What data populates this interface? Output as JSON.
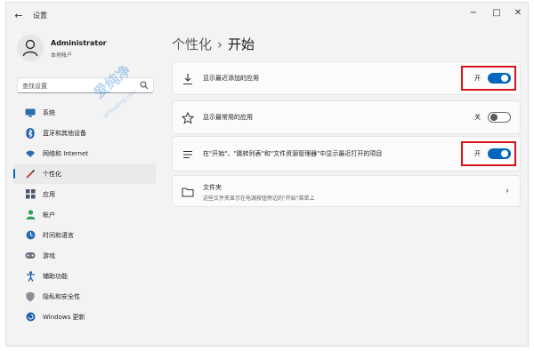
{
  "window": {
    "title": "设置",
    "back_glyph": "←",
    "minimize_glyph": "−",
    "maximize_glyph": "□",
    "close_glyph": "✕"
  },
  "profile": {
    "name": "Administrator",
    "account_type": "本地帐户"
  },
  "search": {
    "placeholder": "查找设置"
  },
  "sidebar": {
    "items": [
      {
        "label": "系统",
        "icon": "monitor-icon",
        "selected": false
      },
      {
        "label": "蓝牙和其他设备",
        "icon": "bluetooth-icon",
        "selected": false
      },
      {
        "label": "网络和 Internet",
        "icon": "wifi-icon",
        "selected": false
      },
      {
        "label": "个性化",
        "icon": "brush-icon",
        "selected": true
      },
      {
        "label": "应用",
        "icon": "apps-icon",
        "selected": false
      },
      {
        "label": "帐户",
        "icon": "person-icon",
        "selected": false
      },
      {
        "label": "时间和语言",
        "icon": "globe-clock-icon",
        "selected": false
      },
      {
        "label": "游戏",
        "icon": "gamepad-icon",
        "selected": false
      },
      {
        "label": "辅助功能",
        "icon": "accessibility-icon",
        "selected": false
      },
      {
        "label": "隐私和安全性",
        "icon": "shield-icon",
        "selected": false
      },
      {
        "label": "Windows 更新",
        "icon": "update-icon",
        "selected": false
      }
    ]
  },
  "main": {
    "breadcrumb_parent": "个性化",
    "breadcrumb_separator": "›",
    "breadcrumb_current": "开始",
    "settings": [
      {
        "label": "显示最近添加的应用",
        "icon": "download-icon",
        "state_text": "开",
        "on": true,
        "highlighted": true
      },
      {
        "label": "显示最常用的应用",
        "icon": "star-icon",
        "state_text": "关",
        "on": false,
        "highlighted": false
      },
      {
        "label": "在\"开始\"、\"跳转列表\"和\"文件资源管理器\"中显示最近打开的项目",
        "icon": "list-icon",
        "state_text": "开",
        "on": true,
        "highlighted": true
      }
    ],
    "folders": {
      "title": "文件夹",
      "description": "这些文件夹显示在电源按钮旁边的\"开始\"菜单上",
      "icon": "folder-icon",
      "chevron": "›"
    }
  },
  "watermark": {
    "text": "爱纯净",
    "sub": "aichunjing.com"
  },
  "colors": {
    "accent": "#0067c0",
    "highlight_box": "#d6131c",
    "background": "#f3f3f3",
    "card": "#fbfbfb"
  }
}
